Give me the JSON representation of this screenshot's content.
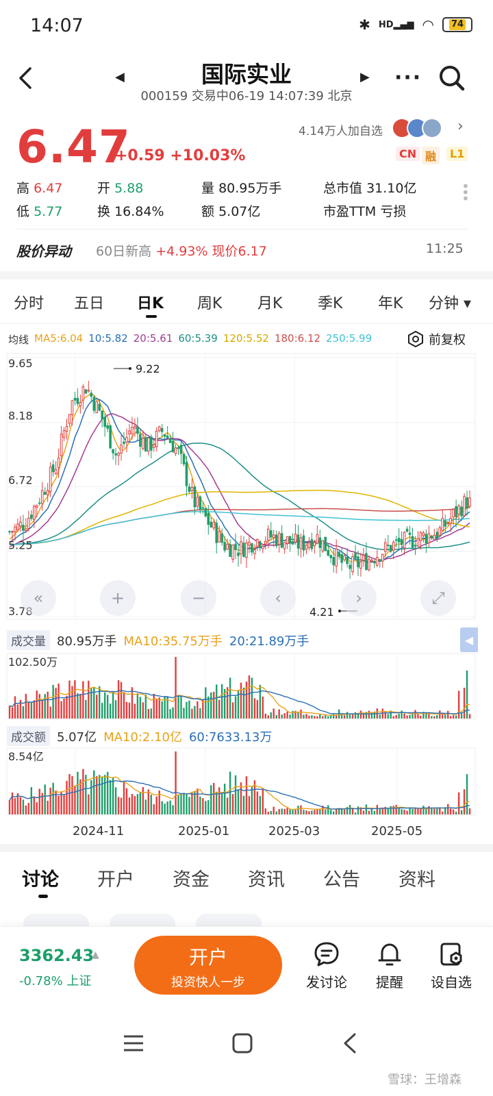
{
  "status": {
    "time": "14:07",
    "battery": "74",
    "hd": "HD"
  },
  "header": {
    "title": "国际实业",
    "subtitle": "000159 交易中06-19 14:07:39 北京"
  },
  "quote": {
    "price": "6.47",
    "change": "+0.59 +10.03%",
    "watch_count": "4.14万人加自选",
    "badges": {
      "cn": "CN",
      "rong": "融",
      "l1": "L1"
    },
    "high_label": "高",
    "high": "6.47",
    "low_label": "低",
    "low": "5.77",
    "open_label": "开",
    "open": "5.88",
    "turnover_label": "换",
    "turnover": "16.84%",
    "volume_label": "量",
    "volume": "80.95万手",
    "amount_label": "额",
    "amount": "5.07亿",
    "mktcap_label": "总市值",
    "mktcap": "31.10亿",
    "pe_label": "市盈TTM",
    "pe": "亏损"
  },
  "alert": {
    "title": "股价异动",
    "text_prefix": "60日新高",
    "text_value": "+4.93% 现价6.17",
    "time": "11:25"
  },
  "period_tabs": [
    "分时",
    "五日",
    "日K",
    "周K",
    "月K",
    "季K",
    "年K",
    "分钟 ▾"
  ],
  "active_period": "日K",
  "ma_legend": {
    "label": "均线",
    "items": [
      {
        "text": "MA5:6.04",
        "color": "#e8a21a"
      },
      {
        "text": "10:5.82",
        "color": "#2a6fb5"
      },
      {
        "text": "20:5.61",
        "color": "#a23b8f"
      },
      {
        "text": "60:5.39",
        "color": "#1d8f86"
      },
      {
        "text": "120:5.52",
        "color": "#e0b400"
      },
      {
        "text": "180:6.12",
        "color": "#c8504c"
      },
      {
        "text": "250:5.99",
        "color": "#3fc2d6"
      }
    ],
    "adjust": "前复权"
  },
  "kline": {
    "y_ticks": [
      "9.65",
      "8.18",
      "6.72",
      "5.25",
      "3.78"
    ],
    "max_label": "9.22",
    "min_label": "4.21"
  },
  "volume": {
    "label": "成交量",
    "value": "80.95万手",
    "ma10": "MA10:35.75万手",
    "ma20": "20:21.89万手",
    "max_tick": "102.50万"
  },
  "amount": {
    "label": "成交额",
    "value": "5.07亿",
    "ma10": "MA10:2.10亿",
    "ma60": "60:7633.13万",
    "max_tick": "8.54亿"
  },
  "x_labels": [
    "2024-11",
    "2025-01",
    "2025-03",
    "2025-05"
  ],
  "content_tabs": [
    "讨论",
    "开户",
    "资金",
    "资讯",
    "公告",
    "资料"
  ],
  "active_content_tab": "讨论",
  "index": {
    "value": "3362.43",
    "change": "-0.78% 上证"
  },
  "open_account": {
    "title": "开户",
    "subtitle": "投资快人一步"
  },
  "actions": {
    "discuss": "发讨论",
    "remind": "提醒",
    "watch": "设自选"
  },
  "watermark": "雪球：王增森",
  "chart_data": {
    "type": "candlestick",
    "x_ticks": [
      "2024-11",
      "2025-01",
      "2025-03",
      "2025-05"
    ],
    "y_ticks": [
      9.65,
      8.18,
      6.72,
      5.25,
      3.78
    ],
    "ylim": [
      3.78,
      9.65
    ],
    "period_high": 9.22,
    "period_low": 4.21,
    "approx_close_path": [
      5.7,
      5.9,
      6.5,
      7.2,
      8.6,
      9.0,
      8.3,
      7.4,
      8.1,
      7.6,
      8.0,
      7.5,
      6.4,
      5.9,
      5.4,
      5.3,
      5.5,
      5.6,
      5.5,
      5.4,
      5.6,
      5.2,
      4.9,
      5.0,
      5.2,
      5.4,
      5.5,
      5.6,
      5.7,
      6.1,
      6.47
    ],
    "ma_values": {
      "MA5": 6.04,
      "MA10": 5.82,
      "MA20": 5.61,
      "MA60": 5.39,
      "MA120": 5.52,
      "MA180": 6.12,
      "MA250": 5.99
    }
  }
}
